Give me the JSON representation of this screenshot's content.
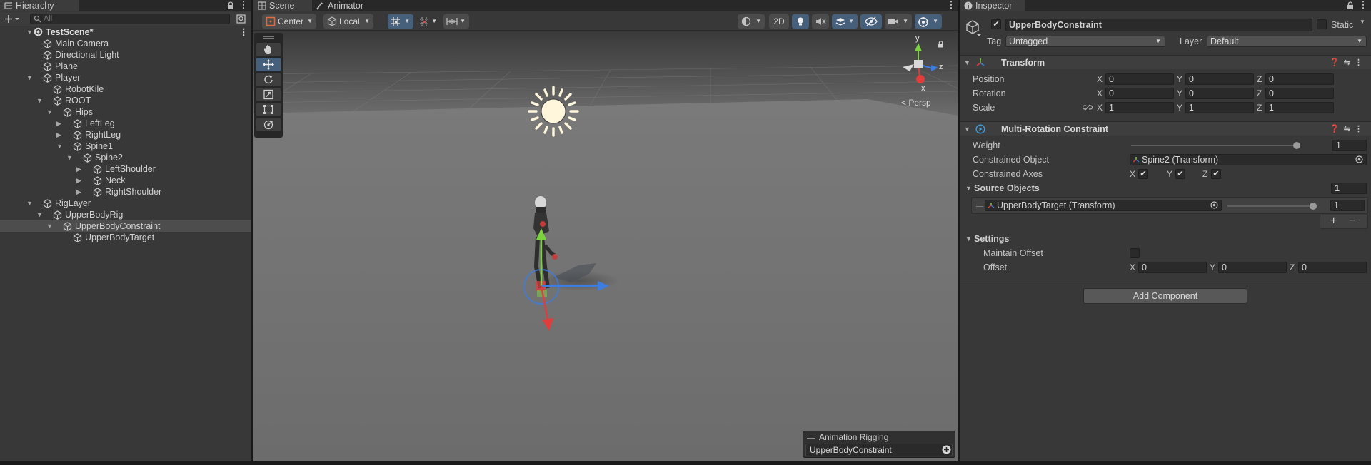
{
  "hierarchy": {
    "tab_label": "Hierarchy",
    "search_placeholder": "All",
    "scene_name": "TestScene*",
    "items": [
      {
        "label": "Main Camera"
      },
      {
        "label": "Directional Light"
      },
      {
        "label": "Plane"
      },
      {
        "label": "Player"
      },
      {
        "label": "RobotKile"
      },
      {
        "label": "ROOT"
      },
      {
        "label": "Hips"
      },
      {
        "label": "LeftLeg"
      },
      {
        "label": "RightLeg"
      },
      {
        "label": "Spine1"
      },
      {
        "label": "Spine2"
      },
      {
        "label": "LeftShoulder"
      },
      {
        "label": "Neck"
      },
      {
        "label": "RightShoulder"
      },
      {
        "label": "RigLayer"
      },
      {
        "label": "UpperBodyRig"
      },
      {
        "label": "UpperBodyConstraint"
      },
      {
        "label": "UpperBodyTarget"
      }
    ]
  },
  "scene": {
    "tabs": [
      {
        "label": "Scene"
      },
      {
        "label": "Animator"
      }
    ],
    "pivot_label": "Center",
    "space_label": "Local",
    "mode_2d": "2D",
    "persp_label": "< Persp",
    "gizmo_labels": {
      "y": "y",
      "x": "x",
      "z": "z"
    },
    "overlay": {
      "title": "Animation Rigging",
      "field_value": "UpperBodyConstraint"
    }
  },
  "inspector": {
    "tab_label": "Inspector",
    "object_name": "UpperBodyConstraint",
    "static_label": "Static",
    "tag_label": "Tag",
    "tag_value": "Untagged",
    "layer_label": "Layer",
    "layer_value": "Default",
    "transform": {
      "title": "Transform",
      "position_label": "Position",
      "rotation_label": "Rotation",
      "scale_label": "Scale",
      "axis_x": "X",
      "axis_y": "Y",
      "axis_z": "Z",
      "position": {
        "x": "0",
        "y": "0",
        "z": "0"
      },
      "rotation": {
        "x": "0",
        "y": "0",
        "z": "0"
      },
      "scale": {
        "x": "1",
        "y": "1",
        "z": "1"
      }
    },
    "mrc": {
      "title": "Multi-Rotation Constraint",
      "weight_label": "Weight",
      "weight_value": "1",
      "weight_fraction": 1,
      "constrained_object_label": "Constrained Object",
      "constrained_object_value": "Spine2 (Transform)",
      "constrained_axes_label": "Constrained Axes",
      "source_objects_label": "Source Objects",
      "source_count": "1",
      "source_item_value": "UpperBodyTarget (Transform)",
      "source_item_weight": "1",
      "source_item_weight_fraction": 1,
      "add_symbol": "+",
      "remove_symbol": "−",
      "settings_label": "Settings",
      "maintain_offset_label": "Maintain Offset",
      "offset_label": "Offset",
      "offset": {
        "x": "0",
        "y": "0",
        "z": "0"
      }
    },
    "add_component_label": "Add Component"
  },
  "colors": {
    "panel_bg": "#383838",
    "selection_blue": "#46607c",
    "gizmo_x": "#e03d3d",
    "gizmo_y": "#7bd33e",
    "gizmo_z": "#3d7ce0"
  }
}
